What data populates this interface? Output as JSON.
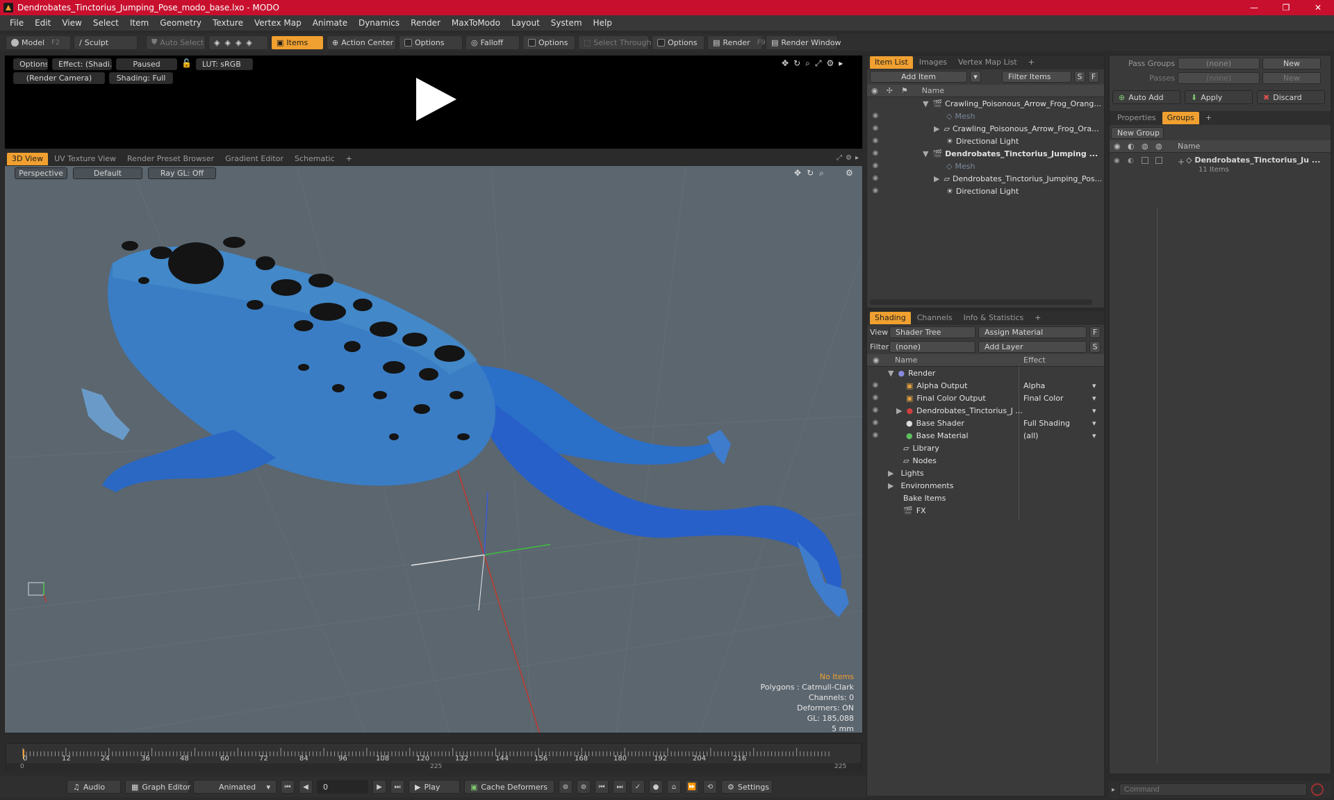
{
  "window": {
    "title": "Dendrobates_Tinctorius_Jumping_Pose_modo_base.lxo - MODO",
    "buttons": [
      "—",
      "❐",
      "✕"
    ]
  },
  "menubar": [
    "File",
    "Edit",
    "View",
    "Select",
    "Item",
    "Geometry",
    "Texture",
    "Vertex Map",
    "Animate",
    "Dynamics",
    "Render",
    "MaxToModo",
    "Layout",
    "System",
    "Help"
  ],
  "toolbar": {
    "model": "Model",
    "model_key": "F2",
    "sculpt": "Sculpt",
    "auto_select": "Auto Select",
    "items": "Items",
    "action_center": "Action Center",
    "options1": "Options",
    "falloff": "Falloff",
    "options2": "Options",
    "select_through": "Select Through",
    "options3": "Options",
    "render": "Render",
    "render_key": "F9",
    "render_window": "Render Window"
  },
  "preview": {
    "options": "Options",
    "effect": "Effect: (Shadi...",
    "paused": "Paused",
    "lut": "LUT: sRGB",
    "camera": "(Render Camera)",
    "shading": "Shading: Full"
  },
  "viewport_tabs": [
    "3D View",
    "UV Texture View",
    "Render Preset Browser",
    "Gradient Editor",
    "Schematic",
    "+"
  ],
  "viewport": {
    "perspective": "Perspective",
    "default": "Default",
    "raygl": "Ray GL: Off",
    "stats": {
      "no_items": "No Items",
      "polygons": "Polygons : Catmull-Clark",
      "channels": "Channels: 0",
      "deformers": "Deformers: ON",
      "gl": "GL: 185,088",
      "unit": "5 mm"
    },
    "colors": {
      "no_items": "#f0a030",
      "background": "#5b666f",
      "frog_blue": "#2a73c8",
      "frog_spots": "#151515"
    }
  },
  "item_list": {
    "tabs": [
      "Item List",
      "Images",
      "Vertex Map List",
      "+"
    ],
    "add_item": "Add Item",
    "filter_items": "Filter Items",
    "s": "S",
    "f": "F",
    "col_name": "Name",
    "rows": [
      "Crawling_Poisonous_Arrow_Frog_Orang...",
      "Mesh",
      "Crawling_Poisonous_Arrow_Frog_Ora...",
      "Directional Light",
      "Dendrobates_Tinctorius_Jumping ...",
      "Mesh",
      "Dendrobates_Tinctorius_Jumping_Pos...",
      "Directional Light"
    ]
  },
  "shading": {
    "tabs": [
      "Shading",
      "Channels",
      "Info & Statistics",
      "+"
    ],
    "view_label": "View",
    "view_value": "Shader Tree",
    "assign_material": "Assign Material",
    "filter_label": "Filter",
    "filter_value": "(none)",
    "add_layer": "Add Layer",
    "f": "F",
    "s": "S",
    "col_name": "Name",
    "col_effect": "Effect",
    "rows": [
      {
        "name": "Render",
        "effect": ""
      },
      {
        "name": "Alpha Output",
        "effect": "Alpha"
      },
      {
        "name": "Final Color Output",
        "effect": "Final Color"
      },
      {
        "name": "Dendrobates_Tinctorius_J ...",
        "effect": ""
      },
      {
        "name": "Base Shader",
        "effect": "Full Shading"
      },
      {
        "name": "Base Material",
        "effect": "(all)"
      },
      {
        "name": "Library",
        "effect": ""
      },
      {
        "name": "Nodes",
        "effect": ""
      },
      {
        "name": "Lights",
        "effect": ""
      },
      {
        "name": "Environments",
        "effect": ""
      },
      {
        "name": "Bake Items",
        "effect": ""
      },
      {
        "name": "FX",
        "effect": ""
      }
    ]
  },
  "right_panel": {
    "pass_groups_label": "Pass Groups",
    "pass_groups_value": "(none)",
    "passes_label": "Passes",
    "passes_value": "(none)",
    "new1": "New",
    "new2": "New",
    "auto_add": "Auto Add",
    "apply": "Apply",
    "discard": "Discard",
    "tabs": [
      "Properties",
      "Groups",
      "+"
    ],
    "new_group": "New Group",
    "col_name": "Name",
    "group_name": "Dendrobates_Tinctorius_Ju ...",
    "group_count": "11 Items"
  },
  "timeline": {
    "ticks": [
      "0",
      "12",
      "24",
      "36",
      "48",
      "60",
      "72",
      "84",
      "96",
      "108",
      "120",
      "132",
      "144",
      "156",
      "168",
      "180",
      "192",
      "204",
      "216"
    ],
    "start": "0",
    "mid": "225",
    "end": "225"
  },
  "transport": {
    "audio": "Audio",
    "graph_editor": "Graph Editor",
    "animated": "Animated",
    "frame": "0",
    "play": "Play",
    "cache_deformers": "Cache Deformers",
    "settings": "Settings"
  },
  "command": {
    "placeholder": "Command"
  }
}
